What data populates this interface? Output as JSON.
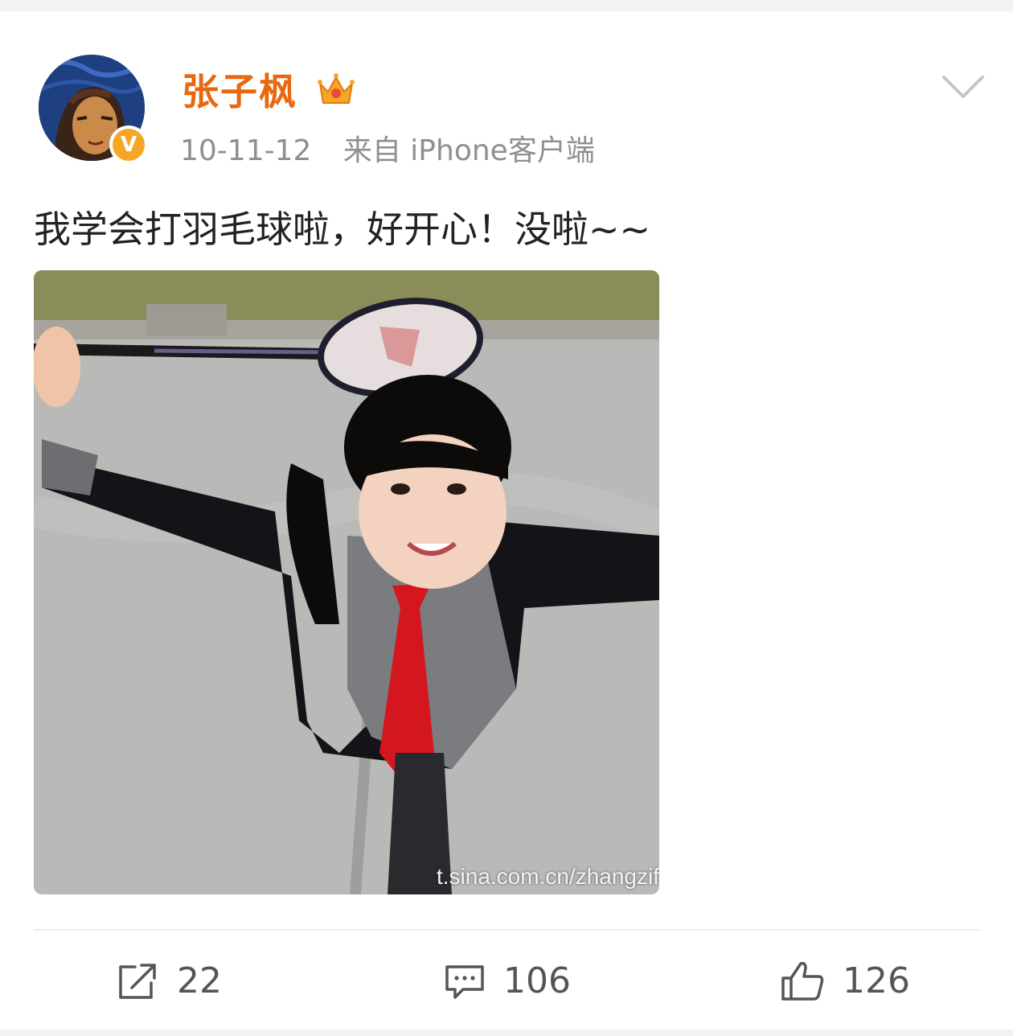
{
  "post": {
    "author": "张子枫",
    "date": "10-11-12",
    "source": "来自 iPhone客户端",
    "text": "我学会打羽毛球啦，好开心！没啦~~",
    "image_watermark": "t.sina.com.cn/zhangzif",
    "verified_badge": "V"
  },
  "actions": {
    "repost_count": "22",
    "comment_count": "106",
    "like_count": "126"
  },
  "icons": {
    "verified": "verified-badge-icon",
    "crown": "crown-icon",
    "more": "chevron-down-icon",
    "repost": "repost-icon",
    "comment": "comment-icon",
    "like": "thumbs-up-icon"
  },
  "colors": {
    "author_name": "#e8680f",
    "verified_badge": "#f5a623",
    "meta_text": "#8f8f8f",
    "action_icon": "#555555"
  }
}
